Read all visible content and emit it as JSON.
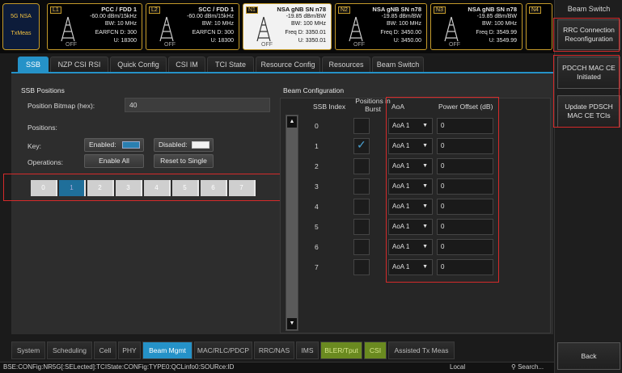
{
  "nsa": {
    "line1": "5G NSA",
    "line2": "TxMeas"
  },
  "cells": [
    {
      "tag": "L1",
      "title": "PCC / FDD    1",
      "l1": "-60.00 dBm/15kHz",
      "l2": "BW:       10 MHz",
      "l3": "EARFCN D:     300",
      "l4": "U:   18300",
      "off": "OFF"
    },
    {
      "tag": "L2",
      "title": "SCC / FDD    1",
      "l1": "-60.00 dBm/15kHz",
      "l2": "BW:       10 MHz",
      "l3": "EARFCN D:     300",
      "l4": "U:   18300",
      "off": "OFF"
    },
    {
      "tag": "N1",
      "title": "NSA gNB SN  n78",
      "l1": "-19.85  dBm/BW",
      "l2": "BW:     100 MHz",
      "l3": "Freq   D:  3350.01",
      "l4": "U:  3350.01",
      "off": "OFF"
    },
    {
      "tag": "N2",
      "title": "NSA gNB SN  n78",
      "l1": "-19.85  dBm/BW",
      "l2": "BW:     100 MHz",
      "l3": "Freq   D:  3450.00",
      "l4": "U:  3450.00",
      "off": "OFF"
    },
    {
      "tag": "N3",
      "title": "NSA gNB SN  n78",
      "l1": "-19.85  dBm/BW",
      "l2": "BW:     100 MHz",
      "l3": "Freq   D:  3549.99",
      "l4": "U:  3549.99",
      "off": "OFF"
    },
    {
      "tag": "N4",
      "title": "",
      "l1": "",
      "l2": "",
      "l3": "",
      "l4": "",
      "off": ""
    }
  ],
  "right_panel": {
    "title": "Beam Switch",
    "buttons": [
      "RRC Connection Reconfiguration",
      "PDCCH MAC CE Initiated",
      "Update PDSCH MAC CE TCIs"
    ],
    "back": "Back"
  },
  "tabs": [
    "SSB",
    "NZP CSI RSI",
    "Quick Config",
    "CSI IM",
    "TCI State",
    "Resource Config",
    "Resources",
    "Beam Switch"
  ],
  "ssb": {
    "section_title": "SSB Positions",
    "bitmap_label": "Position Bitmap (hex):",
    "bitmap_value": "40",
    "positions_label": "Positions:",
    "key_label": "Key:",
    "enabled_label": "Enabled:",
    "disabled_label": "Disabled:",
    "operations_label": "Operations:",
    "enable_all": "Enable All",
    "reset_single": "Reset to Single",
    "positions": [
      "0",
      "1",
      "2",
      "3",
      "4",
      "5",
      "6",
      "7"
    ],
    "enabled_index": "1"
  },
  "beam": {
    "section_title": "Beam Configuration",
    "col_ssb": "SSB Index",
    "col_burst": "Positions in Burst",
    "col_aoa": "AoA",
    "col_pwr": "Power Offset (dB)",
    "rows": [
      {
        "index": "0",
        "checked": false,
        "aoa": "AoA 1",
        "pwr": "0"
      },
      {
        "index": "1",
        "checked": true,
        "aoa": "AoA 1",
        "pwr": "0"
      },
      {
        "index": "2",
        "checked": false,
        "aoa": "AoA 1",
        "pwr": "0"
      },
      {
        "index": "3",
        "checked": false,
        "aoa": "AoA 1",
        "pwr": "0"
      },
      {
        "index": "4",
        "checked": false,
        "aoa": "AoA 1",
        "pwr": "0"
      },
      {
        "index": "5",
        "checked": false,
        "aoa": "AoA 1",
        "pwr": "0"
      },
      {
        "index": "6",
        "checked": false,
        "aoa": "AoA 1",
        "pwr": "0"
      },
      {
        "index": "7",
        "checked": false,
        "aoa": "AoA 1",
        "pwr": "0"
      }
    ]
  },
  "bottom_nav": [
    "System",
    "Scheduling",
    "Cell",
    "PHY",
    "Beam Mgmt",
    "MAC/RLC/PDCP",
    "RRC/NAS",
    "IMS",
    "BLER/Tput",
    "CSI",
    "Assisted Tx Meas"
  ],
  "status": {
    "path": "BSE:CONFig:NR5G[:SELected]:TCIState:CONFig:TYPE0:QCLinfo0:SOURce:ID",
    "mode": "Local",
    "search": "Search..."
  },
  "colors": {
    "accent": "#2592c8",
    "highlight": "#d42a2a",
    "cell_border": "#c49a2a"
  }
}
